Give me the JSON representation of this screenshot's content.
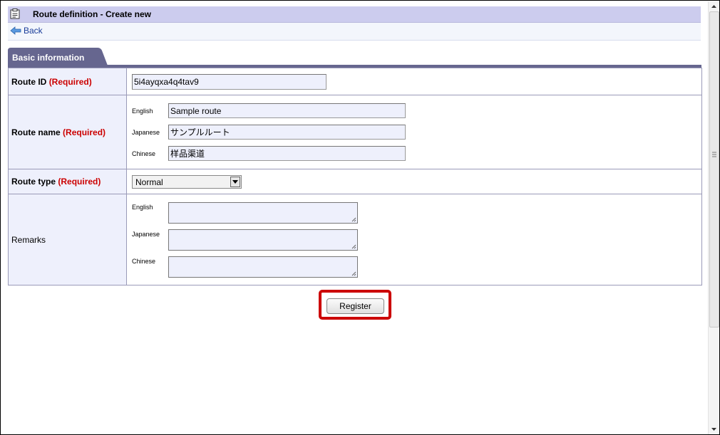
{
  "header": {
    "title": "Route definition - Create new",
    "back_label": "Back"
  },
  "section_tab": "Basic information",
  "form": {
    "required_marker": "(Required)",
    "route_id": {
      "label": "Route ID",
      "value": "5i4ayqxa4q4tav9"
    },
    "route_name": {
      "label": "Route name",
      "english_label": "English",
      "english_value": "Sample route",
      "japanese_label": "Japanese",
      "japanese_value": "サンプルルート",
      "chinese_label": "Chinese",
      "chinese_value": "样品渠道"
    },
    "route_type": {
      "label": "Route type",
      "selected": "Normal"
    },
    "remarks": {
      "label": "Remarks",
      "english_label": "English",
      "japanese_label": "Japanese",
      "chinese_label": "Chinese",
      "english_value": "",
      "japanese_value": "",
      "chinese_value": ""
    }
  },
  "register_label": "Register",
  "colors": {
    "title_bar": "#ccccee",
    "label_cell": "#eef0fc",
    "required": "#cc0000",
    "tab": "#66668f",
    "highlight": "#cc0000"
  },
  "icons": {
    "page": "clipboard-icon",
    "back": "back-arrow-icon",
    "dropdown": "triangle-down-icon"
  }
}
